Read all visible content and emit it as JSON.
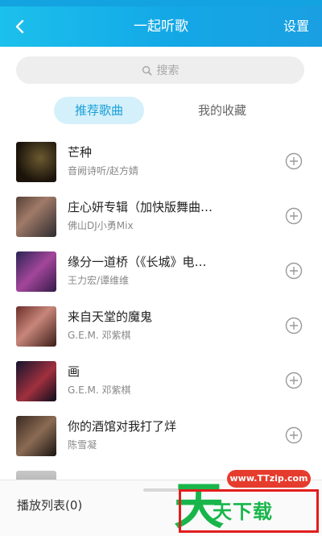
{
  "header": {
    "title": "一起听歌",
    "settings_label": "设置"
  },
  "search": {
    "placeholder": "搜索"
  },
  "tabs": [
    {
      "label": "推荐歌曲",
      "active": true
    },
    {
      "label": "我的收藏",
      "active": false
    }
  ],
  "songs": [
    {
      "title": "芒种",
      "artist": "音阙诗听/赵方婧"
    },
    {
      "title": "庄心妍专辑（加快版舞曲…",
      "artist": "佛山DJ小勇Mix"
    },
    {
      "title": "缘分一道桥（《长城》电…",
      "artist": "王力宏/谭维维"
    },
    {
      "title": "来自天堂的魔鬼",
      "artist": "G.E.M. 邓紫棋"
    },
    {
      "title": "画",
      "artist": "G.E.M. 邓紫棋"
    },
    {
      "title": "你的酒馆对我打了烊",
      "artist": "陈雪凝"
    },
    {
      "title": "",
      "artist": ""
    }
  ],
  "bottom": {
    "playlist_label": "播放列表(0)"
  },
  "watermark": {
    "glyph": "天",
    "url": "www.TTzip.com",
    "text": "天下载"
  },
  "colors": {
    "accent": "#13a7e6",
    "active_tab_bg": "#d4f0fb",
    "watermark_green": "#18b64a",
    "watermark_red": "#e21d1d"
  },
  "icons": {
    "back": "chevron-left-icon",
    "search": "search-icon",
    "add": "add-circle-icon"
  }
}
